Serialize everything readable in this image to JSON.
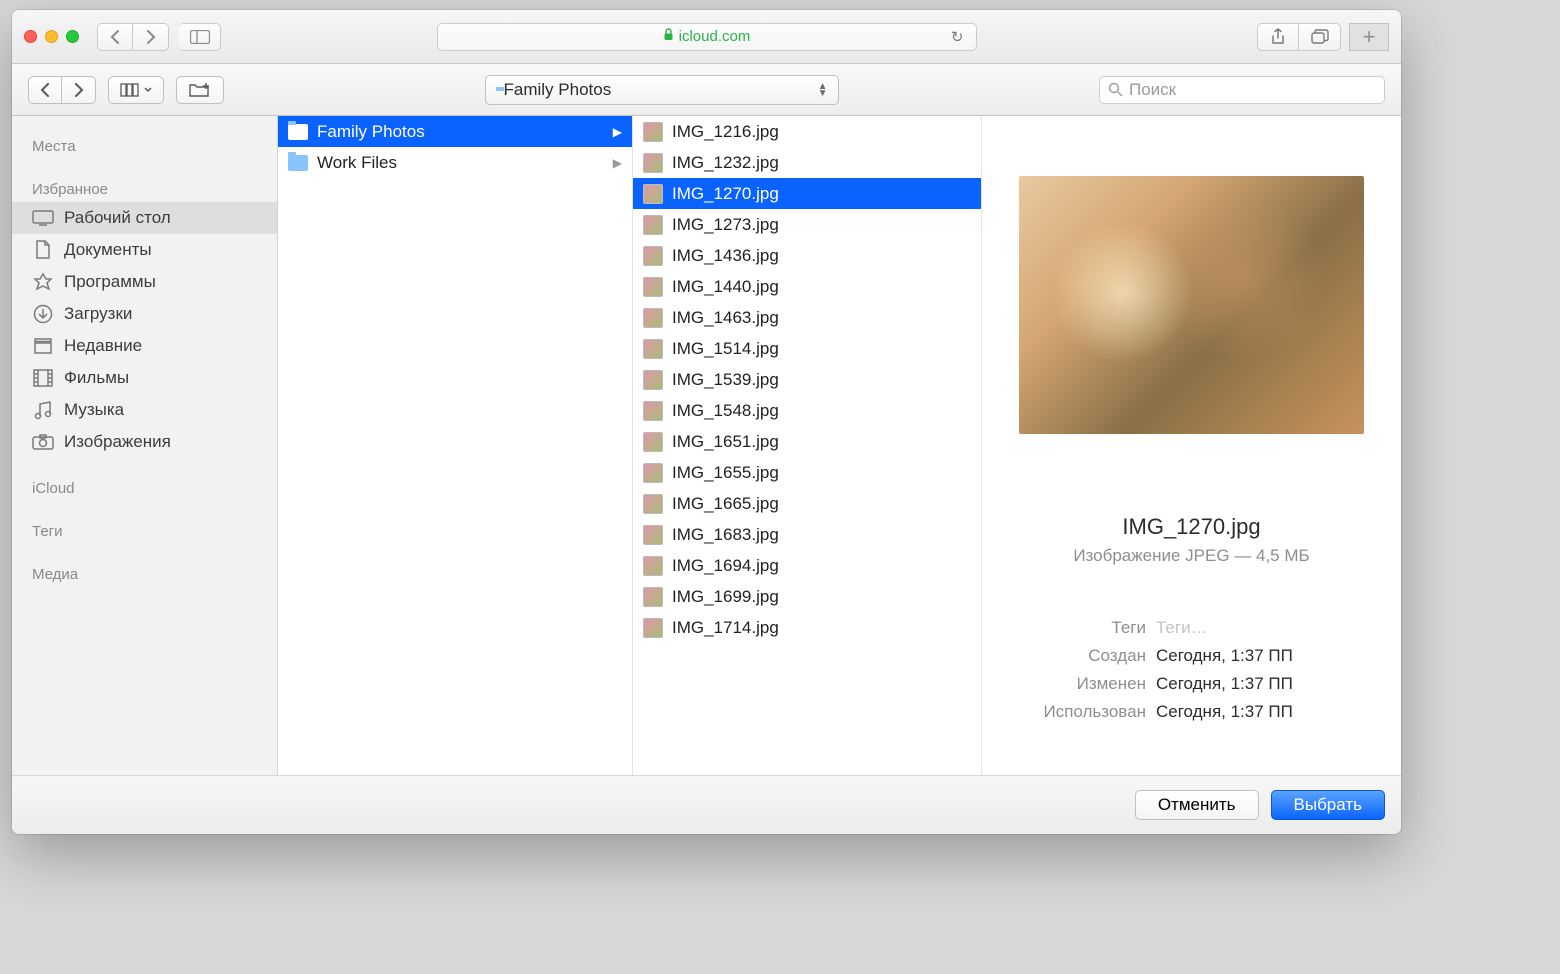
{
  "browser": {
    "url_host": "icloud.com"
  },
  "toolbar": {
    "path_label": "Family Photos",
    "search_placeholder": "Поиск"
  },
  "sidebar": {
    "sections": [
      {
        "header": "Места"
      },
      {
        "header": "Избранное",
        "items": [
          {
            "icon": "desktop",
            "label": "Рабочий стол",
            "selected": true
          },
          {
            "icon": "doc",
            "label": "Документы"
          },
          {
            "icon": "app",
            "label": "Программы"
          },
          {
            "icon": "download",
            "label": "Загрузки"
          },
          {
            "icon": "recent",
            "label": "Недавние"
          },
          {
            "icon": "movie",
            "label": "Фильмы"
          },
          {
            "icon": "music",
            "label": "Музыка"
          },
          {
            "icon": "photo",
            "label": "Изображения"
          }
        ]
      },
      {
        "header": "iCloud"
      },
      {
        "header": "Теги"
      },
      {
        "header": "Медиа"
      }
    ]
  },
  "column1": [
    {
      "label": "Family Photos",
      "selected": true
    },
    {
      "label": "Work Files"
    }
  ],
  "column2": [
    {
      "label": "IMG_1216.jpg"
    },
    {
      "label": "IMG_1232.jpg"
    },
    {
      "label": "IMG_1270.jpg",
      "selected": true
    },
    {
      "label": "IMG_1273.jpg"
    },
    {
      "label": "IMG_1436.jpg"
    },
    {
      "label": "IMG_1440.jpg"
    },
    {
      "label": "IMG_1463.jpg"
    },
    {
      "label": "IMG_1514.jpg"
    },
    {
      "label": "IMG_1539.jpg"
    },
    {
      "label": "IMG_1548.jpg"
    },
    {
      "label": "IMG_1651.jpg"
    },
    {
      "label": "IMG_1655.jpg"
    },
    {
      "label": "IMG_1665.jpg"
    },
    {
      "label": "IMG_1683.jpg"
    },
    {
      "label": "IMG_1694.jpg"
    },
    {
      "label": "IMG_1699.jpg"
    },
    {
      "label": "IMG_1714.jpg"
    }
  ],
  "preview": {
    "filename": "IMG_1270.jpg",
    "description": "Изображение JPEG — 4,5 МБ",
    "meta": {
      "tags_label": "Теги",
      "tags_placeholder": "Теги…",
      "created_label": "Создан",
      "created_value": "Сегодня, 1:37 ПП",
      "modified_label": "Изменен",
      "modified_value": "Сегодня, 1:37 ПП",
      "used_label": "Использован",
      "used_value": "Сегодня, 1:37 ПП"
    }
  },
  "footer": {
    "cancel": "Отменить",
    "choose": "Выбрать"
  }
}
